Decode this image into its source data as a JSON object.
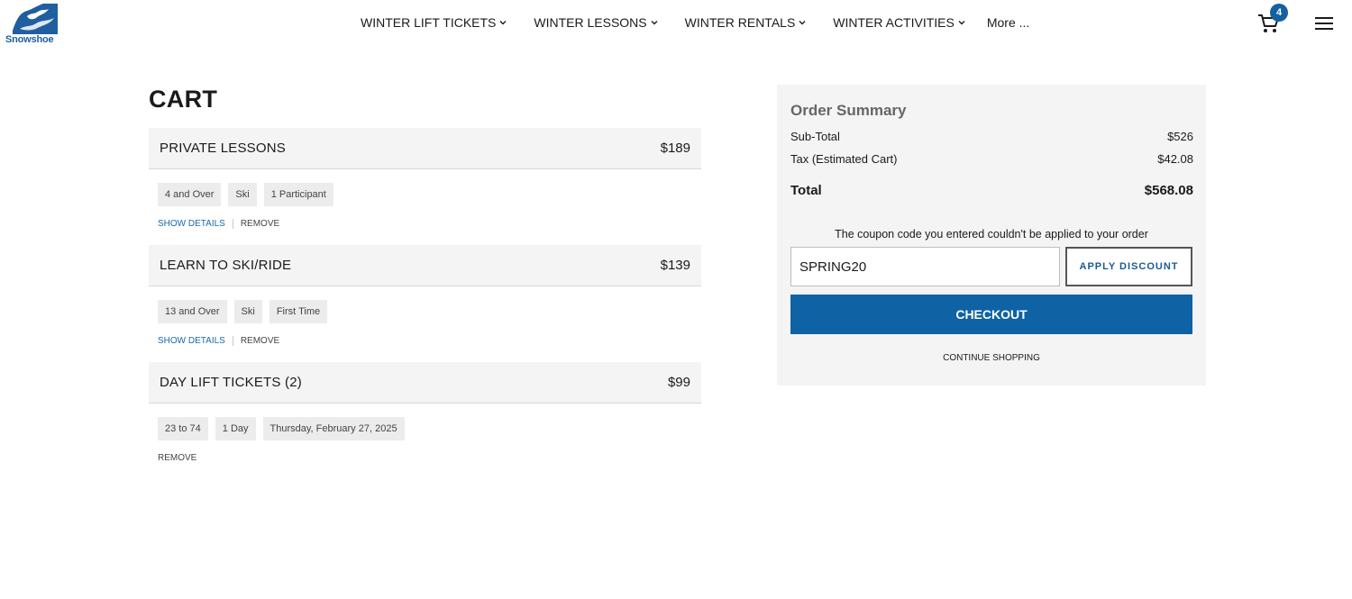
{
  "brand": {
    "name": "Snowshoe",
    "color": "#1f5fa0"
  },
  "nav": {
    "items": [
      {
        "label": "WINTER LIFT TICKETS"
      },
      {
        "label": "WINTER LESSONS"
      },
      {
        "label": "WINTER RENTALS"
      },
      {
        "label": "WINTER ACTIVITIES"
      }
    ],
    "more_label": "More ..."
  },
  "header": {
    "cart_count": "4",
    "cart_icon": "cart-icon",
    "menu_icon": "hamburger-menu-icon"
  },
  "cart": {
    "title": "CART",
    "items": [
      {
        "name": "PRIVATE LESSONS",
        "price": "$189",
        "tags": [
          "4 and Over",
          "Ski",
          "1 Participant"
        ],
        "show_details": "SHOW DETAILS",
        "remove": "REMOVE"
      },
      {
        "name": "LEARN TO SKI/RIDE",
        "price": "$139",
        "tags": [
          "13 and Over",
          "Ski",
          "First Time"
        ],
        "show_details": "SHOW DETAILS",
        "remove": "REMOVE"
      },
      {
        "name": "DAY LIFT TICKETS (2)",
        "price": "$99",
        "tags": [
          "23 to 74",
          "1 Day",
          "Thursday, February 27, 2025"
        ],
        "remove": "REMOVE"
      }
    ]
  },
  "summary": {
    "title": "Order Summary",
    "subtotal_label": "Sub-Total",
    "subtotal_value": "$526",
    "tax_label": "Tax (Estimated Cart)",
    "tax_value": "$42.08",
    "total_label": "Total",
    "total_value": "$568.08",
    "coupon_message": "The coupon code you entered couldn't be applied to your order",
    "coupon_value": "SPRING20",
    "apply_label": "APPLY DISCOUNT",
    "checkout_label": "CHECKOUT",
    "continue_label": "CONTINUE SHOPPING",
    "accent_color": "#0f62a3"
  }
}
